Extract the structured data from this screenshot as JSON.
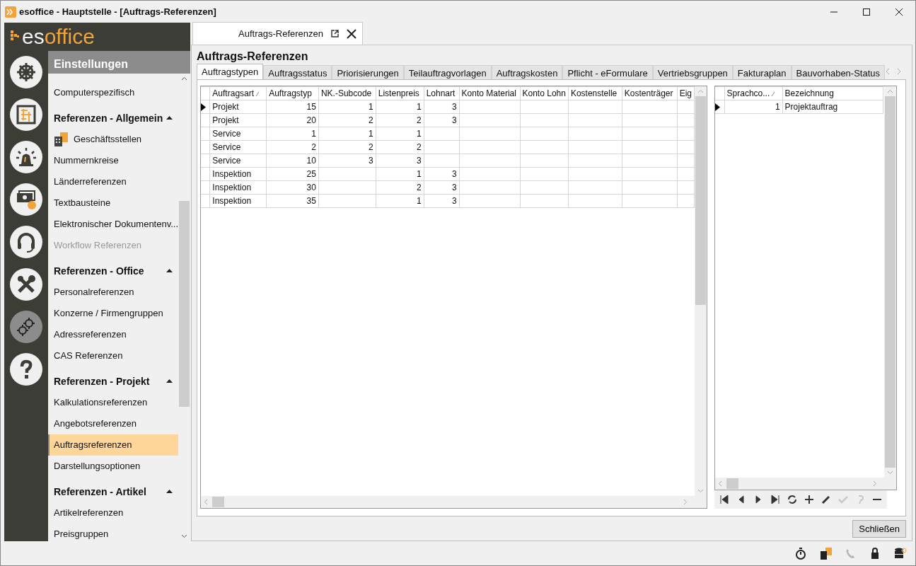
{
  "window": {
    "title": "esoffice - Hauptstelle - [Auftrags-Referenzen]"
  },
  "logo": {
    "prefix": "es",
    "suffix": "office"
  },
  "rail": [
    {
      "kind": "helm",
      "selected": false
    },
    {
      "kind": "plan",
      "selected": false
    },
    {
      "kind": "siren",
      "selected": false
    },
    {
      "kind": "money",
      "selected": false
    },
    {
      "kind": "headset",
      "selected": false
    },
    {
      "kind": "tools",
      "selected": false
    },
    {
      "kind": "gears",
      "selected": true
    },
    {
      "kind": "help",
      "selected": false
    }
  ],
  "sidebar": {
    "header": "Einstellungen",
    "items": [
      {
        "kind": "item",
        "label": "Computerspezifisch",
        "selected": false,
        "disabled": false
      },
      {
        "kind": "group",
        "label": "Referenzen - Allgemein",
        "expanded": true
      },
      {
        "kind": "icon-item",
        "label": "Geschäftsstellen",
        "selected": false,
        "disabled": false
      },
      {
        "kind": "item",
        "label": "Nummernkreise",
        "selected": false,
        "disabled": false
      },
      {
        "kind": "item",
        "label": "Länderreferenzen",
        "selected": false,
        "disabled": false
      },
      {
        "kind": "item",
        "label": "Textbausteine",
        "selected": false,
        "disabled": false
      },
      {
        "kind": "item",
        "label": "Elektronischer Dokumentenv...",
        "selected": false,
        "disabled": false
      },
      {
        "kind": "item",
        "label": "Workflow Referenzen",
        "selected": false,
        "disabled": true
      },
      {
        "kind": "group",
        "label": "Referenzen - Office",
        "expanded": true
      },
      {
        "kind": "item",
        "label": "Personalreferenzen",
        "selected": false,
        "disabled": false
      },
      {
        "kind": "item",
        "label": "Konzerne / Firmengruppen",
        "selected": false,
        "disabled": false
      },
      {
        "kind": "item",
        "label": "Adressreferenzen",
        "selected": false,
        "disabled": false
      },
      {
        "kind": "item",
        "label": "CAS Referenzen",
        "selected": false,
        "disabled": false
      },
      {
        "kind": "group",
        "label": "Referenzen - Projekt",
        "expanded": true
      },
      {
        "kind": "item",
        "label": "Kalkulationsreferenzen",
        "selected": false,
        "disabled": false
      },
      {
        "kind": "item",
        "label": "Angebotsreferenzen",
        "selected": false,
        "disabled": false
      },
      {
        "kind": "item",
        "label": "Auftragsreferenzen",
        "selected": true,
        "disabled": false
      },
      {
        "kind": "item",
        "label": "Darstellungsoptionen",
        "selected": false,
        "disabled": false
      },
      {
        "kind": "group",
        "label": "Referenzen - Artikel",
        "expanded": true
      },
      {
        "kind": "item",
        "label": "Artikelreferenzen",
        "selected": false,
        "disabled": false
      },
      {
        "kind": "item",
        "label": "Preisgruppen",
        "selected": false,
        "disabled": false
      }
    ]
  },
  "document_tab": {
    "label": "Auftrags-Referenzen"
  },
  "panel_title": "Auftrags-Referenzen",
  "tabs": [
    {
      "label": "Auftragstypen",
      "selected": true
    },
    {
      "label": "Auftragsstatus",
      "selected": false
    },
    {
      "label": "Priorisierungen",
      "selected": false
    },
    {
      "label": "Teilauftragvorlagen",
      "selected": false
    },
    {
      "label": "Auftragskosten",
      "selected": false
    },
    {
      "label": "Pflicht - eFormulare",
      "selected": false
    },
    {
      "label": "Vertriebsgruppen",
      "selected": false
    },
    {
      "label": "Fakturaplan",
      "selected": false
    },
    {
      "label": "Bauvorhaben-Status",
      "selected": false
    }
  ],
  "main_grid": {
    "columns": [
      {
        "label": "Auftragsart",
        "sorted": true,
        "kind": "text"
      },
      {
        "label": "Auftragstyp",
        "sorted": false,
        "kind": "number"
      },
      {
        "label": "NK.-Subcode",
        "sorted": false,
        "kind": "number"
      },
      {
        "label": "Listenpreis",
        "sorted": false,
        "kind": "number"
      },
      {
        "label": "Lohnart",
        "sorted": false,
        "kind": "number"
      },
      {
        "label": "Konto Material",
        "sorted": false,
        "kind": "text"
      },
      {
        "label": "Konto Lohn",
        "sorted": false,
        "kind": "text"
      },
      {
        "label": "Kostenstelle",
        "sorted": false,
        "kind": "text"
      },
      {
        "label": "Kostenträger",
        "sorted": false,
        "kind": "text"
      },
      {
        "label": "Eig",
        "sorted": false,
        "kind": "text"
      }
    ],
    "rows": [
      {
        "current": true,
        "cells": [
          "Projekt",
          "15",
          "1",
          "1",
          "3",
          "",
          "",
          "",
          "",
          ""
        ]
      },
      {
        "current": false,
        "cells": [
          "Projekt",
          "20",
          "2",
          "2",
          "3",
          "",
          "",
          "",
          "",
          ""
        ]
      },
      {
        "current": false,
        "cells": [
          "Service",
          "1",
          "1",
          "1",
          "",
          "",
          "",
          "",
          "",
          ""
        ]
      },
      {
        "current": false,
        "cells": [
          "Service",
          "2",
          "2",
          "2",
          "",
          "",
          "",
          "",
          "",
          ""
        ]
      },
      {
        "current": false,
        "cells": [
          "Service",
          "10",
          "3",
          "3",
          "",
          "",
          "",
          "",
          "",
          ""
        ]
      },
      {
        "current": false,
        "cells": [
          "Inspektion",
          "25",
          "",
          "1",
          "3",
          "",
          "",
          "",
          "",
          ""
        ]
      },
      {
        "current": false,
        "cells": [
          "Inspektion",
          "30",
          "",
          "2",
          "3",
          "",
          "",
          "",
          "",
          ""
        ]
      },
      {
        "current": false,
        "cells": [
          "Inspektion",
          "35",
          "",
          "1",
          "3",
          "",
          "",
          "",
          "",
          ""
        ]
      }
    ]
  },
  "detail_grid": {
    "columns": [
      {
        "label": "Sprachco...",
        "sorted": true,
        "kind": "number"
      },
      {
        "label": "Bezeichnung",
        "sorted": false,
        "kind": "text"
      }
    ],
    "rows": [
      {
        "current": true,
        "cells": [
          "1",
          "Projektauftrag"
        ]
      }
    ]
  },
  "navigator": [
    {
      "kind": "first",
      "disabled": false
    },
    {
      "kind": "prev",
      "disabled": false
    },
    {
      "kind": "next",
      "disabled": false
    },
    {
      "kind": "last",
      "disabled": false
    },
    {
      "kind": "refresh",
      "disabled": false
    },
    {
      "kind": "add",
      "disabled": false
    },
    {
      "kind": "edit",
      "disabled": false
    },
    {
      "kind": "post",
      "disabled": true
    },
    {
      "kind": "cancel",
      "disabled": true
    },
    {
      "kind": "delete",
      "disabled": false
    }
  ],
  "close_button": "Schließen",
  "status_bar": {
    "icons": [
      {
        "kind": "stopwatch",
        "disabled": false
      },
      {
        "kind": "building",
        "disabled": false
      },
      {
        "kind": "phone",
        "disabled": true
      },
      {
        "kind": "lock",
        "disabled": false
      },
      {
        "kind": "database",
        "disabled": false
      }
    ]
  }
}
